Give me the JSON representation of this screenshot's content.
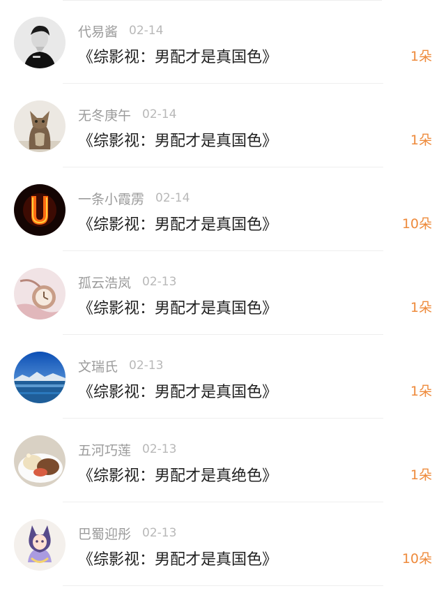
{
  "rows": [
    {
      "username": "代易酱",
      "date": "02-14",
      "title": "《综影视：男配才是真国色》",
      "count": "1朵"
    },
    {
      "username": "无冬庚午",
      "date": "02-14",
      "title": "《综影视：男配才是真国色》",
      "count": "1朵"
    },
    {
      "username": "一条小霞雳",
      "date": "02-14",
      "title": "《综影视：男配才是真国色》",
      "count": "10朵"
    },
    {
      "username": "孤云浩岚",
      "date": "02-13",
      "title": "《综影视：男配才是真国色》",
      "count": "1朵"
    },
    {
      "username": "文瑞氏",
      "date": "02-13",
      "title": "《综影视：男配才是真国色》",
      "count": "1朵"
    },
    {
      "username": "五河巧莲",
      "date": "02-13",
      "title": "《综影视：男配才是真绝色》",
      "count": "1朵"
    },
    {
      "username": "巴蜀迎彤",
      "date": "02-13",
      "title": "《综影视：男配才是真国色》",
      "count": "10朵"
    }
  ],
  "colors": {
    "accent": "#ee8a3b",
    "username": "#9b9b9b",
    "date": "#b8b8b8",
    "title": "#222222",
    "divider": "#eeeeee"
  }
}
